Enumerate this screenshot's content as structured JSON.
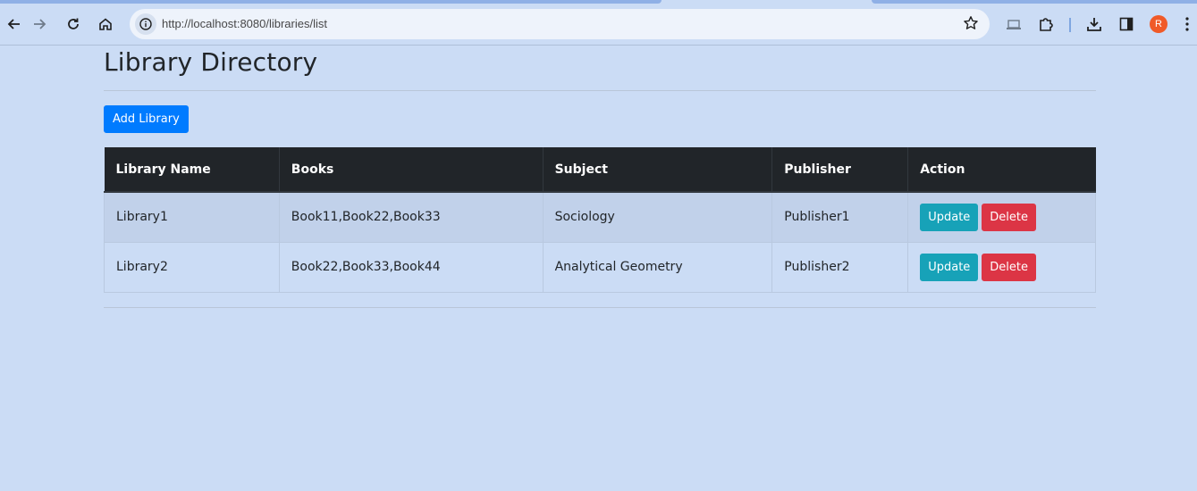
{
  "browser": {
    "url": "http://localhost:8080/libraries/list",
    "profile_initial": "R",
    "accent_color": "#8fb0e6"
  },
  "page": {
    "title": "Library Directory",
    "add_button_label": "Add Library",
    "background_color": "#cbdcf5"
  },
  "table": {
    "headers": [
      "Library Name",
      "Books",
      "Subject",
      "Publisher",
      "Action"
    ],
    "rows": [
      {
        "name": "Library1",
        "books": "Book11,Book22,Book33",
        "subject": "Sociology",
        "publisher": "Publisher1",
        "update_label": "Update",
        "delete_label": "Delete"
      },
      {
        "name": "Library2",
        "books": "Book22,Book33,Book44",
        "subject": "Analytical Geometry",
        "publisher": "Publisher2",
        "update_label": "Update",
        "delete_label": "Delete"
      }
    ]
  },
  "colors": {
    "primary": "#007bff",
    "info": "#17a2b8",
    "danger": "#dc3545",
    "header_dark": "#212529"
  }
}
